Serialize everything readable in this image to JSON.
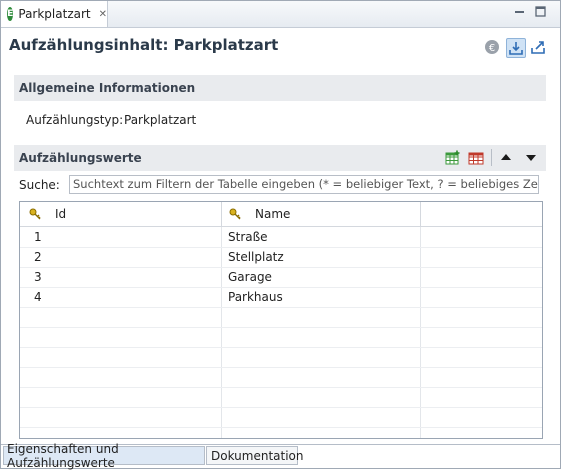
{
  "editor_tab": {
    "label": "Parkplatzart",
    "icon_letter": "E"
  },
  "header": {
    "title": "Aufzählungsinhalt: Parkplatzart"
  },
  "general": {
    "section_title": "Allgemeine Informationen",
    "type_label": "Aufzählungstyp:",
    "type_value": "Parkplatzart"
  },
  "values": {
    "section_title": "Aufzählungswerte",
    "search_label": "Suche:",
    "search_placeholder": "Suchtext zum Filtern der Tabelle eingeben (* = beliebiger Text, ? = beliebiges Zeichen, | tr",
    "columns": [
      "Id",
      "Name"
    ],
    "rows": [
      {
        "id": "1",
        "name": "Straße"
      },
      {
        "id": "2",
        "name": "Stellplatz"
      },
      {
        "id": "3",
        "name": "Garage"
      },
      {
        "id": "4",
        "name": "Parkhaus"
      }
    ]
  },
  "bottom_tabs": [
    {
      "label": "Eigenschaften und Aufzählungswerte",
      "active": true
    },
    {
      "label": "Dokumentation",
      "active": false
    }
  ],
  "colors": {
    "accent": "#2e8b3a",
    "section_bg": "#e9ebee",
    "title": "#2b3a4a"
  }
}
